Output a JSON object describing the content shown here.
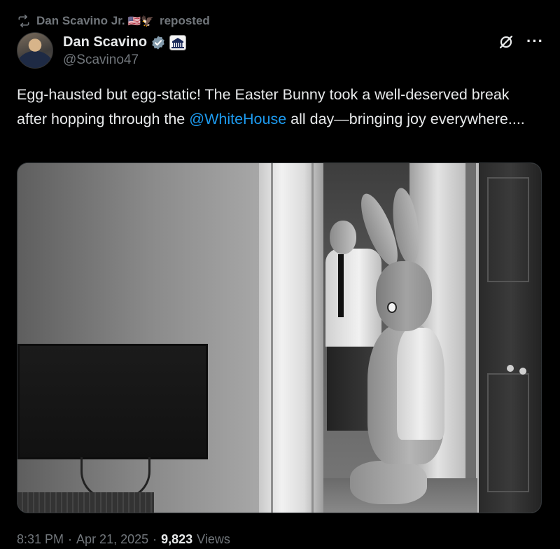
{
  "repost": {
    "reposter_name": "Dan Scavino Jr.",
    "flags": "🇺🇸🦅",
    "label": "reposted"
  },
  "author": {
    "name": "Dan Scavino",
    "handle": "@Scavino47"
  },
  "tweet": {
    "text_before": "Egg-hausted but egg-static! The Easter Bunny took a well-deserved break after hopping through the ",
    "mention": "@WhiteHouse",
    "text_after": " all day—bringing joy everywhere...."
  },
  "meta": {
    "time": "8:31 PM",
    "separator1": "·",
    "date": "Apr 21, 2025",
    "separator2": "·",
    "views_count": "9,823",
    "views_label": "Views"
  },
  "icons": {
    "repost": "repost-icon",
    "verified": "verified-badge-icon",
    "institution": "white-house-icon",
    "grok": "grok-icon",
    "more": "more-options-icon"
  },
  "colors": {
    "background": "#000000",
    "text": "#e7e9ea",
    "muted": "#71767b",
    "link": "#1d9bf0",
    "verified": "#829aab"
  }
}
